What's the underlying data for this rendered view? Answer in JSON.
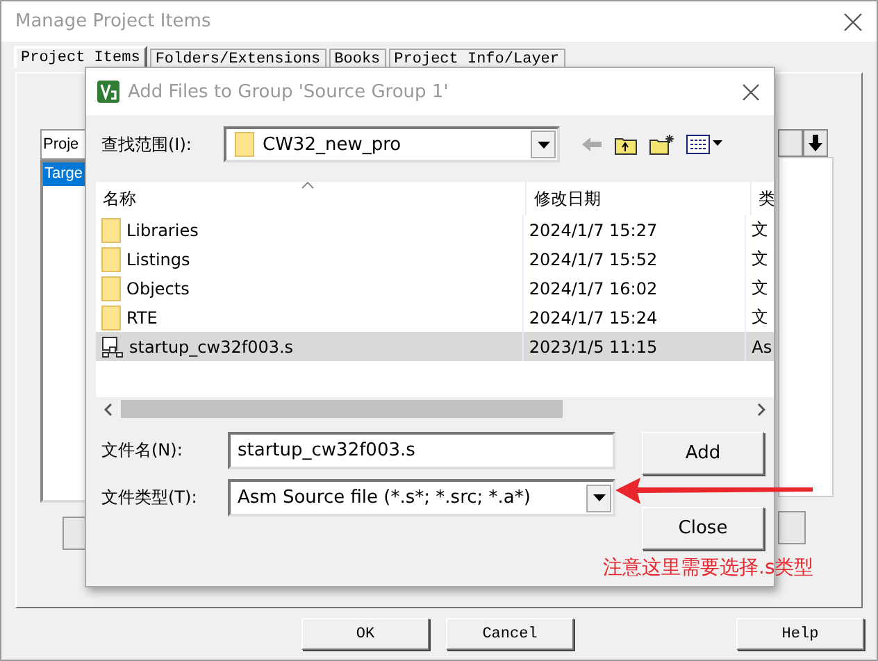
{
  "window": {
    "title": "Manage Project Items"
  },
  "tabs": [
    {
      "label": "Project Items",
      "selected": true
    },
    {
      "label": "Folders/Extensions",
      "selected": false
    },
    {
      "label": "Books",
      "selected": false
    },
    {
      "label": "Project Info/Layer",
      "selected": false
    }
  ],
  "project_panel": {
    "header": "Proje",
    "items": [
      {
        "label": "Targe",
        "selected": true
      }
    ]
  },
  "buttons": [
    "OK",
    "Cancel",
    "Help"
  ],
  "dialog": {
    "title": "Add Files to Group 'Source Group 1'",
    "look_in": {
      "label": "查找范围(I):",
      "value": "CW32_new_pro"
    },
    "columns": [
      "名称",
      "修改日期",
      "类"
    ],
    "files": [
      {
        "kind": "folder",
        "name": "Libraries",
        "modified": "2024/1/7 15:27",
        "type": "文",
        "selected": false
      },
      {
        "kind": "folder",
        "name": "Listings",
        "modified": "2024/1/7 15:52",
        "type": "文",
        "selected": false
      },
      {
        "kind": "folder",
        "name": "Objects",
        "modified": "2024/1/7 16:02",
        "type": "文",
        "selected": false
      },
      {
        "kind": "folder",
        "name": "RTE",
        "modified": "2024/1/7 15:24",
        "type": "文",
        "selected": false
      },
      {
        "kind": "file",
        "name": "startup_cw32f003.s",
        "modified": "2023/1/5 11:15",
        "type": "As",
        "selected": true
      }
    ],
    "file_name": {
      "label": "文件名(N):",
      "value": "startup_cw32f003.s"
    },
    "file_type": {
      "label": "文件类型(T):",
      "value": "Asm Source file (*.s*; *.src; *.a*)"
    },
    "buttons": [
      "Add",
      "Close"
    ]
  },
  "annotation": {
    "text": "注意这里需要选择.s类型"
  }
}
